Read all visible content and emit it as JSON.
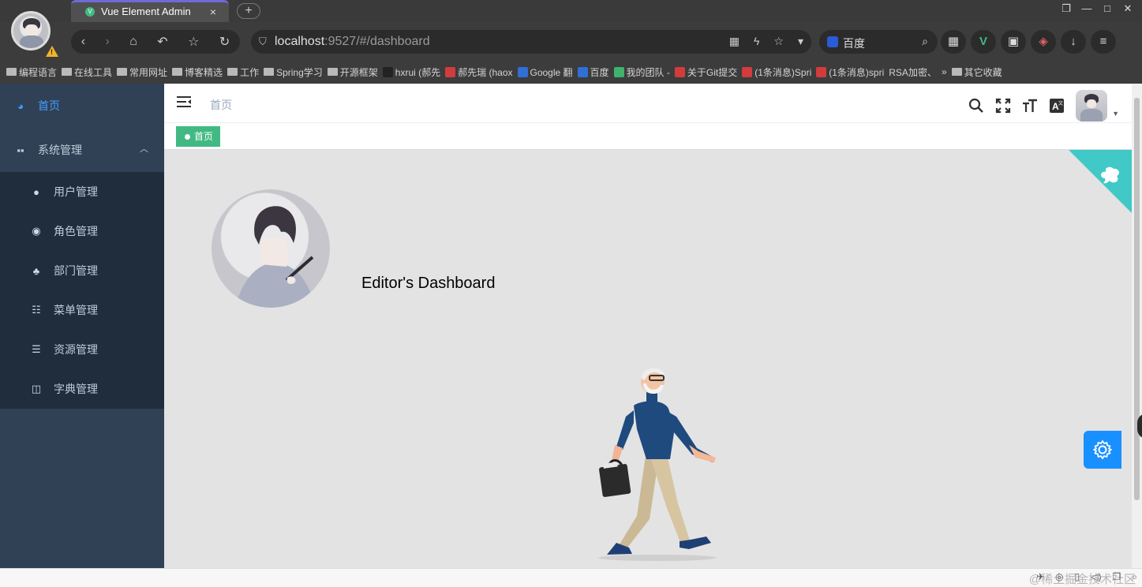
{
  "browser": {
    "tab_title": "Vue Element Admin",
    "tab_close": "×",
    "new_tab": "+",
    "url_host": "localhost",
    "url_rest": ":9527/#/dashboard",
    "search_engine": "百度",
    "window_controls": [
      "❐",
      "—",
      "□",
      "✕"
    ],
    "bookmarks": [
      {
        "label": "编程语言",
        "kind": "folder"
      },
      {
        "label": "在线工具",
        "kind": "folder"
      },
      {
        "label": "常用网址",
        "kind": "folder"
      },
      {
        "label": "博客精选",
        "kind": "folder"
      },
      {
        "label": "工作",
        "kind": "folder"
      },
      {
        "label": "Spring学习",
        "kind": "folder"
      },
      {
        "label": "开源框架",
        "kind": "folder"
      },
      {
        "label": "hxrui (郝先",
        "kind": "github"
      },
      {
        "label": "郝先瑞 (haox",
        "kind": "red"
      },
      {
        "label": "Google 翻",
        "kind": "blue"
      },
      {
        "label": "百度",
        "kind": "blue"
      },
      {
        "label": "我的团队 -",
        "kind": "green"
      },
      {
        "label": "关于Git提交",
        "kind": "red"
      },
      {
        "label": "(1条消息)Spri",
        "kind": "red"
      },
      {
        "label": "(1条消息)spri",
        "kind": "red"
      },
      {
        "label": "RSA加密、",
        "kind": "none"
      },
      {
        "label": "»",
        "kind": "none"
      },
      {
        "label": "其它收藏",
        "kind": "folder"
      }
    ]
  },
  "sidebar": {
    "home": {
      "label": "首页",
      "icon": "dashboard-icon"
    },
    "system": {
      "label": "系统管理",
      "icon": "grid-icon"
    },
    "items": [
      {
        "label": "用户管理",
        "icon": "user-icon"
      },
      {
        "label": "角色管理",
        "icon": "peoples-icon"
      },
      {
        "label": "部门管理",
        "icon": "tree-icon"
      },
      {
        "label": "菜单管理",
        "icon": "tree-table-icon"
      },
      {
        "label": "资源管理",
        "icon": "list-icon"
      },
      {
        "label": "字典管理",
        "icon": "education-icon"
      }
    ]
  },
  "navbar": {
    "breadcrumb": "首页"
  },
  "tags": {
    "active": "首页"
  },
  "dashboard": {
    "title": "Editor's Dashboard"
  },
  "status": {
    "watermark": "@稀土掘金技术社区"
  },
  "colors": {
    "sidebar_bg": "#304156",
    "submenu_bg": "#1f2d3d",
    "active_menu": "#409eff",
    "tag_active": "#42b983",
    "settings_button": "#1890ff",
    "github_corner": "#40c9c6"
  }
}
